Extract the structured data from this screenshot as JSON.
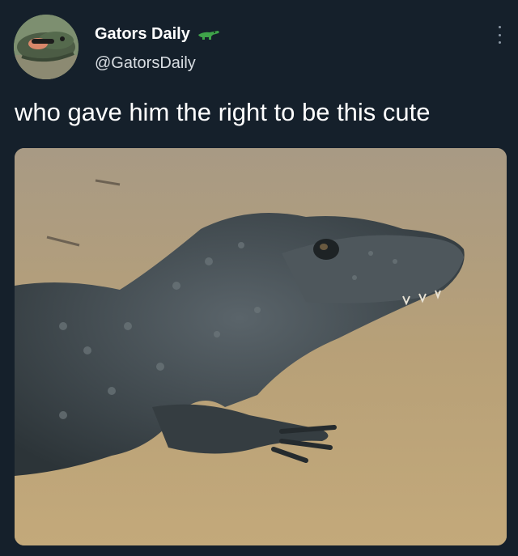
{
  "tweet": {
    "display_name": "Gators Daily",
    "handle": "@GatorsDaily",
    "text": "who gave him the right to be this cute",
    "more_icon": "more-horizontal-icon",
    "name_emoji_icon": "crocodile-emoji-icon"
  },
  "colors": {
    "background": "#15202b",
    "primary_text": "#ffffff",
    "secondary_text": "#d9dee3",
    "icon_muted": "#8b98a5"
  }
}
